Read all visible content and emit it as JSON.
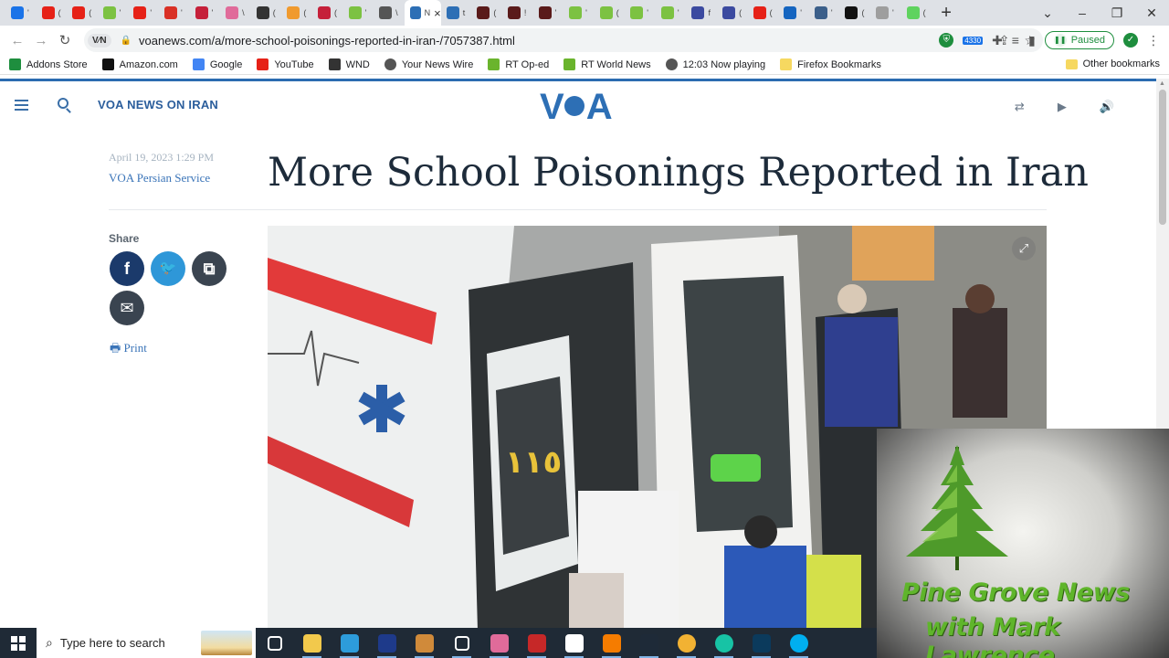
{
  "browser": {
    "tabs": [
      {
        "icon": "blue-square-icon",
        "color": "#1a73e8",
        "short": "'"
      },
      {
        "icon": "youtube-icon",
        "color": "#e62117",
        "short": "("
      },
      {
        "icon": "youtube-icon",
        "color": "#e62117",
        "short": "("
      },
      {
        "icon": "leaf-icon",
        "color": "#7cc242",
        "short": "'"
      },
      {
        "icon": "youtube-icon",
        "color": "#e62117",
        "short": "'"
      },
      {
        "icon": "gmail-icon",
        "color": "#d93025",
        "short": "'"
      },
      {
        "icon": "b-icon",
        "color": "#c5203a",
        "short": "'"
      },
      {
        "icon": "figure-icon",
        "color": "#e06b9a",
        "short": "\\"
      },
      {
        "icon": "wnd-icon",
        "color": "#333333",
        "short": "("
      },
      {
        "icon": "orange-icon",
        "color": "#f09a2e",
        "short": "("
      },
      {
        "icon": "b-icon",
        "color": "#c5203a",
        "short": "("
      },
      {
        "icon": "leaf-icon",
        "color": "#7cc242",
        "short": "'"
      },
      {
        "icon": "dark-square-icon",
        "color": "#555555",
        "short": "\\"
      },
      {
        "icon": "voa-icon",
        "color": "#2d6fb5",
        "short": "N",
        "active": true
      },
      {
        "icon": "voa-icon",
        "color": "#2d6fb5",
        "short": "t"
      },
      {
        "icon": "dark-square-icon",
        "color": "#5a1a1a",
        "short": "("
      },
      {
        "icon": "dark-square-icon",
        "color": "#5a1a1a",
        "short": "!"
      },
      {
        "icon": "dark-square-icon",
        "color": "#5a1a1a",
        "short": "'"
      },
      {
        "icon": "leaf-icon",
        "color": "#7cc242",
        "short": "'"
      },
      {
        "icon": "leaf-icon",
        "color": "#7cc242",
        "short": "("
      },
      {
        "icon": "leaf-icon",
        "color": "#7cc242",
        "short": "'"
      },
      {
        "icon": "leaf-icon",
        "color": "#7cc242",
        "short": "'"
      },
      {
        "icon": "globe-icon",
        "color": "#3b4aa0",
        "short": "f"
      },
      {
        "icon": "globe-icon",
        "color": "#3b4aa0",
        "short": "("
      },
      {
        "icon": "youtube-icon",
        "color": "#e62117",
        "short": "("
      },
      {
        "icon": "cp-icon",
        "color": "#1565c0",
        "short": "'"
      },
      {
        "icon": "crest-icon",
        "color": "#3b5f8a",
        "short": "'"
      },
      {
        "icon": "circle-icon",
        "color": "#111111",
        "short": "("
      },
      {
        "icon": "wave-icon",
        "color": "#9e9e9e",
        "short": "'"
      },
      {
        "icon": "play-icon",
        "color": "#5fd35f",
        "short": "("
      }
    ],
    "new_tab": "+",
    "window_controls": [
      "–",
      "❐",
      "✕"
    ],
    "url": "voanews.com/a/more-school-poisonings-reported-in-iran-/7057387.html",
    "site_chip": "V⁄N",
    "extension_badge": "4330",
    "paused_label": "Paused",
    "bookmarks": [
      {
        "label": "Addons Store",
        "icon": "addons-icon",
        "color": "#1e8e3e"
      },
      {
        "label": "Amazon.com",
        "icon": "amazon-icon",
        "color": "#111111"
      },
      {
        "label": "Google",
        "icon": "google-icon",
        "color": "#4285f4"
      },
      {
        "label": "YouTube",
        "icon": "youtube-icon",
        "color": "#e62117"
      },
      {
        "label": "WND",
        "icon": "wnd-icon",
        "color": "#333333"
      },
      {
        "label": "Your News Wire",
        "icon": "globe-icon",
        "color": "#555555"
      },
      {
        "label": "RT Op-ed",
        "icon": "rt-icon",
        "color": "#6ab42d"
      },
      {
        "label": "RT World News",
        "icon": "rt-icon",
        "color": "#6ab42d"
      },
      {
        "label": "12:03  Now playing",
        "icon": "globe-icon",
        "color": "#555555"
      },
      {
        "label": "Firefox Bookmarks",
        "icon": "folder-icon",
        "color": "#f6d860"
      }
    ],
    "other_bookmarks": "Other bookmarks"
  },
  "voa": {
    "section_title": "VOA NEWS ON IRAN",
    "logo_left": "V",
    "logo_right": "A",
    "date": "April 19, 2023 1:29 PM",
    "source": "VOA Persian Service",
    "headline": "More School Poisonings Reported in Iran",
    "share_label": "Share",
    "share_facebook": "f",
    "share_twitter": "🐦",
    "share_copy": "⧉",
    "share_email": "✉",
    "print_label": "Print",
    "photo_plate": "١١٥",
    "colors": {
      "brand": "#2d6fb5",
      "facebook": "#1b3a6b",
      "twitter": "#2e97d8",
      "copy": "#3a4450",
      "email": "#3a4450"
    }
  },
  "overlay": {
    "title": "Pine Grove News",
    "subtitle": "with Mark Lawrence"
  },
  "taskbar": {
    "search_placeholder": "Type here to search",
    "apps": [
      {
        "icon": "task-view-icon",
        "color": "#ffffff"
      },
      {
        "icon": "file-explorer-icon",
        "color": "#f2c94c"
      },
      {
        "icon": "pen-app-icon",
        "color": "#2d9cdb"
      },
      {
        "icon": "headset-app-icon",
        "color": "#1e3a8a"
      },
      {
        "icon": "mixer-app-icon",
        "color": "#d08a3a"
      },
      {
        "icon": "settings-icon",
        "color": "#ffffff"
      },
      {
        "icon": "puzzle-app-icon",
        "color": "#e06b9a"
      },
      {
        "icon": "maple-app-icon",
        "color": "#c62828"
      },
      {
        "icon": "document-icon",
        "color": "#ffffff"
      },
      {
        "icon": "orange-app-icon",
        "color": "#f57c00"
      },
      {
        "icon": "k-app-icon",
        "color": "#1e2a38"
      },
      {
        "icon": "chrome-icon",
        "color": "#f2b233"
      },
      {
        "icon": "play-app-icon",
        "color": "#17c3a5"
      },
      {
        "icon": "terminal-app-icon",
        "color": "#0b3a5c"
      },
      {
        "icon": "skype-icon",
        "color": "#00aff0"
      }
    ]
  }
}
